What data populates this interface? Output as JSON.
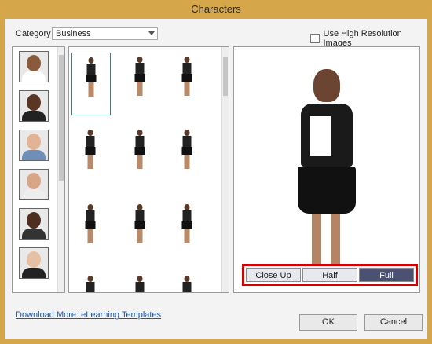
{
  "window": {
    "title": "Characters"
  },
  "category": {
    "label": "Category :",
    "value": "Business"
  },
  "hires": {
    "label": "Use High Resolution Images",
    "checked": false
  },
  "thumbnails": [
    {
      "name": "woman-1",
      "skin": "#8a5a3c",
      "hair": "#1c120c",
      "shirt": "#fff"
    },
    {
      "name": "man-1",
      "skin": "#5a3624",
      "hair": "#111",
      "shirt": "#222"
    },
    {
      "name": "man-2",
      "skin": "#e2b394",
      "hair": "#5a3a24",
      "shirt": "#6f8fb8"
    },
    {
      "name": "man-3",
      "skin": "#d8a586",
      "hair": "#3b2818",
      "shirt": "#eee"
    },
    {
      "name": "man-4",
      "skin": "#4e2e1e",
      "hair": "#aaa",
      "shirt": "#333"
    },
    {
      "name": "woman-2",
      "skin": "#e6c0a2",
      "hair": "#2e1c12",
      "shirt": "#222"
    }
  ],
  "view_buttons": [
    {
      "label": "Close Up",
      "active": false
    },
    {
      "label": "Half",
      "active": false
    },
    {
      "label": "Full",
      "active": true
    }
  ],
  "download": {
    "label": "Download More: eLearning Templates"
  },
  "ok": {
    "label": "OK"
  },
  "cancel": {
    "label": "Cancel"
  }
}
